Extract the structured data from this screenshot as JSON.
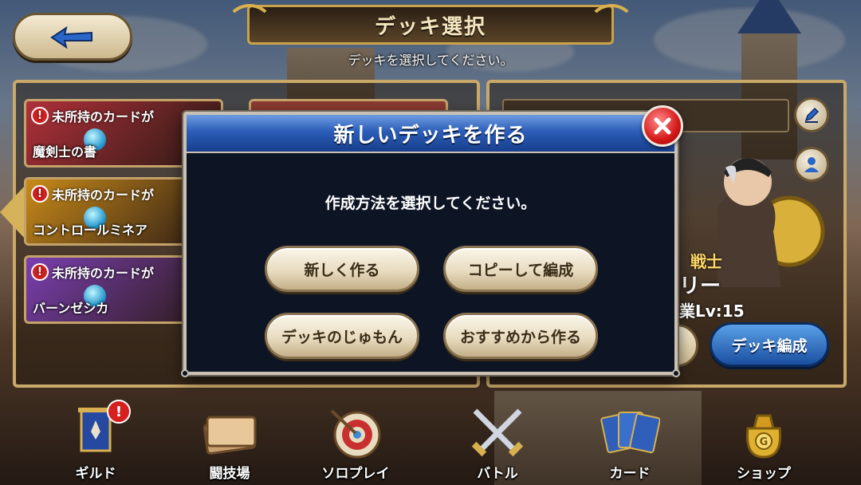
{
  "header": {
    "title": "デッキ選択",
    "subtitle": "デッキを選択してください。"
  },
  "deck_list": [
    {
      "warning": "未所持のカードが",
      "name": "魔剣士の書",
      "color": "#b0303a"
    },
    {
      "warning": "未所持のカードが",
      "name": "コントロールミネア",
      "color": "#c88a1a"
    },
    {
      "warning": "未所持のカードが",
      "name": "バーンゼシカ",
      "color": "#7a3fb0"
    }
  ],
  "right_panel": {
    "class_label": "戦士",
    "hero_name_partial": "リー",
    "level_label": "業Lv:15",
    "edit_button": "デッキ編成"
  },
  "modal": {
    "title": "新しいデッキを作る",
    "prompt": "作成方法を選択してください。",
    "options": [
      {
        "label": "新しく作る"
      },
      {
        "label": "コピーして編成"
      },
      {
        "label": "デッキのじゅもん"
      },
      {
        "label": "おすすめから作る"
      }
    ]
  },
  "bottom_nav": [
    {
      "label": "ギルド",
      "icon": "guild-banner-icon",
      "badge": "!"
    },
    {
      "label": "闘技場",
      "icon": "arena-ticket-icon"
    },
    {
      "label": "ソロプレイ",
      "icon": "target-icon"
    },
    {
      "label": "バトル",
      "icon": "crossed-swords-icon"
    },
    {
      "label": "カード",
      "icon": "cards-icon"
    },
    {
      "label": "ショップ",
      "icon": "gold-bag-icon"
    }
  ],
  "colors": {
    "modal_header": "#2b5db8",
    "close_button": "#d41818",
    "edit_button": "#1b4fa0",
    "option_button": "#e8dcc0"
  }
}
